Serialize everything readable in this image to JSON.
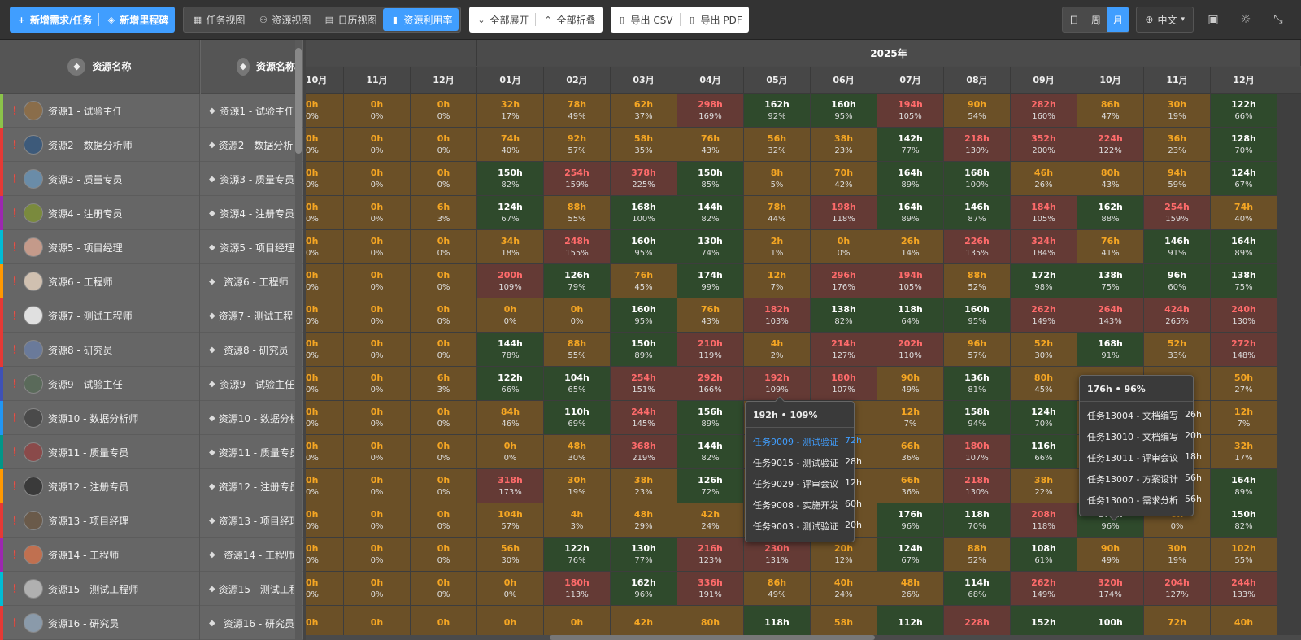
{
  "toolbar": {
    "add_task": "新增需求/任务",
    "add_milestone": "新增里程碑",
    "views": [
      "任务视图",
      "资源视图",
      "日历视图",
      "资源利用率"
    ],
    "active_view": 3,
    "expand_all": "全部展开",
    "collapse_all": "全部折叠",
    "export_csv": "导出 CSV",
    "export_pdf": "导出 PDF",
    "scale": [
      "日",
      "周",
      "月"
    ],
    "active_scale": 2,
    "language": "中文"
  },
  "left_header": {
    "col1": "资源名称",
    "col2": "资源名称"
  },
  "resources": [
    {
      "name": "资源1 - 试验主任",
      "stripe": "#8bc34a",
      "avatar": "#8a6d4a"
    },
    {
      "name": "资源2 - 数据分析师",
      "stripe": "#e53935",
      "avatar": "#3d5a7a"
    },
    {
      "name": "资源3 - 质量专员",
      "stripe": "#e53935",
      "avatar": "#6a8ca8"
    },
    {
      "name": "资源4 - 注册专员",
      "stripe": "#9c27b0",
      "avatar": "#7a8a3d"
    },
    {
      "name": "资源5 - 项目经理",
      "stripe": "#00bcd4",
      "avatar": "#c49a8a"
    },
    {
      "name": "资源6 - 工程师",
      "stripe": "#ff9800",
      "avatar": "#d0c0b0"
    },
    {
      "name": "资源7 - 测试工程师",
      "stripe": "#e53935",
      "avatar": "#e0e0e0"
    },
    {
      "name": "资源8 - 研究员",
      "stripe": "#e53935",
      "avatar": "#6a7a9a"
    },
    {
      "name": "资源9 - 试验主任",
      "stripe": "#3f51b5",
      "avatar": "#5a6a5a"
    },
    {
      "name": "资源10 - 数据分析师",
      "stripe": "#2196f3",
      "avatar": "#4a4a4a"
    },
    {
      "name": "资源11 - 质量专员",
      "stripe": "#009688",
      "avatar": "#8a4a4a"
    },
    {
      "name": "资源12 - 注册专员",
      "stripe": "#ff9800",
      "avatar": "#3a3a3a"
    },
    {
      "name": "资源13 - 项目经理",
      "stripe": "#e53935",
      "avatar": "#6a5a4a"
    },
    {
      "name": "资源14 - 工程师",
      "stripe": "#9c27b0",
      "avatar": "#c07050"
    },
    {
      "name": "资源15 - 测试工程师",
      "stripe": "#00bcd4",
      "avatar": "#b0b0b0"
    },
    {
      "name": "资源16 - 研究员",
      "stripe": "#e53935",
      "avatar": "#8a9aaa"
    }
  ],
  "year_label": "2025年",
  "months": [
    "10月",
    "11月",
    "12月",
    "01月",
    "02月",
    "03月",
    "04月",
    "05月",
    "06月",
    "07月",
    "08月",
    "09月",
    "10月",
    "11月",
    "12月"
  ],
  "cells": [
    [
      [
        "0h",
        "0%"
      ],
      [
        "0h",
        "0%"
      ],
      [
        "0h",
        "0%"
      ],
      [
        "32h",
        "17%"
      ],
      [
        "78h",
        "49%"
      ],
      [
        "62h",
        "37%"
      ],
      [
        "298h",
        "169%"
      ],
      [
        "162h",
        "92%"
      ],
      [
        "160h",
        "95%"
      ],
      [
        "194h",
        "105%"
      ],
      [
        "90h",
        "54%"
      ],
      [
        "282h",
        "160%"
      ],
      [
        "86h",
        "47%"
      ],
      [
        "30h",
        "19%"
      ],
      [
        "122h",
        "66%"
      ]
    ],
    [
      [
        "0h",
        "0%"
      ],
      [
        "0h",
        "0%"
      ],
      [
        "0h",
        "0%"
      ],
      [
        "74h",
        "40%"
      ],
      [
        "92h",
        "57%"
      ],
      [
        "58h",
        "35%"
      ],
      [
        "76h",
        "43%"
      ],
      [
        "56h",
        "32%"
      ],
      [
        "38h",
        "23%"
      ],
      [
        "142h",
        "77%"
      ],
      [
        "218h",
        "130%"
      ],
      [
        "352h",
        "200%"
      ],
      [
        "224h",
        "122%"
      ],
      [
        "36h",
        "23%"
      ],
      [
        "128h",
        "70%"
      ]
    ],
    [
      [
        "0h",
        "0%"
      ],
      [
        "0h",
        "0%"
      ],
      [
        "0h",
        "0%"
      ],
      [
        "150h",
        "82%"
      ],
      [
        "254h",
        "159%"
      ],
      [
        "378h",
        "225%"
      ],
      [
        "150h",
        "85%"
      ],
      [
        "8h",
        "5%"
      ],
      [
        "70h",
        "42%"
      ],
      [
        "164h",
        "89%"
      ],
      [
        "168h",
        "100%"
      ],
      [
        "46h",
        "26%"
      ],
      [
        "80h",
        "43%"
      ],
      [
        "94h",
        "59%"
      ],
      [
        "124h",
        "67%"
      ]
    ],
    [
      [
        "0h",
        "0%"
      ],
      [
        "0h",
        "0%"
      ],
      [
        "6h",
        "3%"
      ],
      [
        "124h",
        "67%"
      ],
      [
        "88h",
        "55%"
      ],
      [
        "168h",
        "100%"
      ],
      [
        "144h",
        "82%"
      ],
      [
        "78h",
        "44%"
      ],
      [
        "198h",
        "118%"
      ],
      [
        "164h",
        "89%"
      ],
      [
        "146h",
        "87%"
      ],
      [
        "184h",
        "105%"
      ],
      [
        "162h",
        "88%"
      ],
      [
        "254h",
        "159%"
      ],
      [
        "74h",
        "40%"
      ]
    ],
    [
      [
        "0h",
        "0%"
      ],
      [
        "0h",
        "0%"
      ],
      [
        "0h",
        "0%"
      ],
      [
        "34h",
        "18%"
      ],
      [
        "248h",
        "155%"
      ],
      [
        "160h",
        "95%"
      ],
      [
        "130h",
        "74%"
      ],
      [
        "2h",
        "1%"
      ],
      [
        "0h",
        "0%"
      ],
      [
        "26h",
        "14%"
      ],
      [
        "226h",
        "135%"
      ],
      [
        "324h",
        "184%"
      ],
      [
        "76h",
        "41%"
      ],
      [
        "146h",
        "91%"
      ],
      [
        "164h",
        "89%"
      ]
    ],
    [
      [
        "0h",
        "0%"
      ],
      [
        "0h",
        "0%"
      ],
      [
        "0h",
        "0%"
      ],
      [
        "200h",
        "109%"
      ],
      [
        "126h",
        "79%"
      ],
      [
        "76h",
        "45%"
      ],
      [
        "174h",
        "99%"
      ],
      [
        "12h",
        "7%"
      ],
      [
        "296h",
        "176%"
      ],
      [
        "194h",
        "105%"
      ],
      [
        "88h",
        "52%"
      ],
      [
        "172h",
        "98%"
      ],
      [
        "138h",
        "75%"
      ],
      [
        "96h",
        "60%"
      ],
      [
        "138h",
        "75%"
      ]
    ],
    [
      [
        "0h",
        "0%"
      ],
      [
        "0h",
        "0%"
      ],
      [
        "0h",
        "0%"
      ],
      [
        "0h",
        "0%"
      ],
      [
        "0h",
        "0%"
      ],
      [
        "160h",
        "95%"
      ],
      [
        "76h",
        "43%"
      ],
      [
        "182h",
        "103%"
      ],
      [
        "138h",
        "82%"
      ],
      [
        "118h",
        "64%"
      ],
      [
        "160h",
        "95%"
      ],
      [
        "262h",
        "149%"
      ],
      [
        "264h",
        "143%"
      ],
      [
        "424h",
        "265%"
      ],
      [
        "240h",
        "130%"
      ]
    ],
    [
      [
        "0h",
        "0%"
      ],
      [
        "0h",
        "0%"
      ],
      [
        "0h",
        "0%"
      ],
      [
        "144h",
        "78%"
      ],
      [
        "88h",
        "55%"
      ],
      [
        "150h",
        "89%"
      ],
      [
        "210h",
        "119%"
      ],
      [
        "4h",
        "2%"
      ],
      [
        "214h",
        "127%"
      ],
      [
        "202h",
        "110%"
      ],
      [
        "96h",
        "57%"
      ],
      [
        "52h",
        "30%"
      ],
      [
        "168h",
        "91%"
      ],
      [
        "52h",
        "33%"
      ],
      [
        "272h",
        "148%"
      ]
    ],
    [
      [
        "0h",
        "0%"
      ],
      [
        "0h",
        "0%"
      ],
      [
        "6h",
        "3%"
      ],
      [
        "122h",
        "66%"
      ],
      [
        "104h",
        "65%"
      ],
      [
        "254h",
        "151%"
      ],
      [
        "292h",
        "166%"
      ],
      [
        "192h",
        "109%"
      ],
      [
        "180h",
        "107%"
      ],
      [
        "90h",
        "49%"
      ],
      [
        "136h",
        "81%"
      ],
      [
        "80h",
        "45%"
      ],
      [
        "",
        ""
      ],
      [
        "",
        ""
      ],
      [
        "50h",
        "27%"
      ]
    ],
    [
      [
        "0h",
        "0%"
      ],
      [
        "0h",
        "0%"
      ],
      [
        "0h",
        "0%"
      ],
      [
        "84h",
        "46%"
      ],
      [
        "110h",
        "69%"
      ],
      [
        "244h",
        "145%"
      ],
      [
        "156h",
        "89%"
      ],
      [
        "",
        ""
      ],
      [
        "",
        ""
      ],
      [
        "12h",
        "7%"
      ],
      [
        "158h",
        "94%"
      ],
      [
        "124h",
        "70%"
      ],
      [
        "",
        ""
      ],
      [
        "",
        ""
      ],
      [
        "12h",
        "7%"
      ]
    ],
    [
      [
        "0h",
        "0%"
      ],
      [
        "0h",
        "0%"
      ],
      [
        "0h",
        "0%"
      ],
      [
        "0h",
        "0%"
      ],
      [
        "48h",
        "30%"
      ],
      [
        "368h",
        "219%"
      ],
      [
        "144h",
        "82%"
      ],
      [
        "",
        ""
      ],
      [
        "",
        ""
      ],
      [
        "66h",
        "36%"
      ],
      [
        "180h",
        "107%"
      ],
      [
        "116h",
        "66%"
      ],
      [
        "",
        ""
      ],
      [
        "",
        ""
      ],
      [
        "32h",
        "17%"
      ]
    ],
    [
      [
        "0h",
        "0%"
      ],
      [
        "0h",
        "0%"
      ],
      [
        "0h",
        "0%"
      ],
      [
        "318h",
        "173%"
      ],
      [
        "30h",
        "19%"
      ],
      [
        "38h",
        "23%"
      ],
      [
        "126h",
        "72%"
      ],
      [
        "",
        ""
      ],
      [
        "",
        ""
      ],
      [
        "66h",
        "36%"
      ],
      [
        "218h",
        "130%"
      ],
      [
        "38h",
        "22%"
      ],
      [
        "",
        ""
      ],
      [
        "",
        ""
      ],
      [
        "164h",
        "89%"
      ]
    ],
    [
      [
        "0h",
        "0%"
      ],
      [
        "0h",
        "0%"
      ],
      [
        "0h",
        "0%"
      ],
      [
        "104h",
        "57%"
      ],
      [
        "4h",
        "3%"
      ],
      [
        "48h",
        "29%"
      ],
      [
        "42h",
        "24%"
      ],
      [
        "",
        ""
      ],
      [
        "",
        ""
      ],
      [
        "176h",
        "96%"
      ],
      [
        "118h",
        "70%"
      ],
      [
        "208h",
        "118%"
      ],
      [
        "176h",
        "96%"
      ],
      [
        "0h",
        "0%"
      ],
      [
        "150h",
        "82%"
      ]
    ],
    [
      [
        "0h",
        "0%"
      ],
      [
        "0h",
        "0%"
      ],
      [
        "0h",
        "0%"
      ],
      [
        "56h",
        "30%"
      ],
      [
        "122h",
        "76%"
      ],
      [
        "130h",
        "77%"
      ],
      [
        "216h",
        "123%"
      ],
      [
        "230h",
        "131%"
      ],
      [
        "20h",
        "12%"
      ],
      [
        "124h",
        "67%"
      ],
      [
        "88h",
        "52%"
      ],
      [
        "108h",
        "61%"
      ],
      [
        "90h",
        "49%"
      ],
      [
        "30h",
        "19%"
      ],
      [
        "102h",
        "55%"
      ]
    ],
    [
      [
        "0h",
        "0%"
      ],
      [
        "0h",
        "0%"
      ],
      [
        "0h",
        "0%"
      ],
      [
        "0h",
        "0%"
      ],
      [
        "180h",
        "113%"
      ],
      [
        "162h",
        "96%"
      ],
      [
        "336h",
        "191%"
      ],
      [
        "86h",
        "49%"
      ],
      [
        "40h",
        "24%"
      ],
      [
        "48h",
        "26%"
      ],
      [
        "114h",
        "68%"
      ],
      [
        "262h",
        "149%"
      ],
      [
        "320h",
        "174%"
      ],
      [
        "204h",
        "127%"
      ],
      [
        "244h",
        "133%"
      ]
    ],
    [
      [
        "0h",
        ""
      ],
      [
        "0h",
        ""
      ],
      [
        "0h",
        ""
      ],
      [
        "0h",
        ""
      ],
      [
        "0h",
        ""
      ],
      [
        "42h",
        ""
      ],
      [
        "80h",
        ""
      ],
      [
        "118h",
        ""
      ],
      [
        "58h",
        ""
      ],
      [
        "112h",
        ""
      ],
      [
        "228h",
        ""
      ],
      [
        "152h",
        ""
      ],
      [
        "100h",
        ""
      ],
      [
        "72h",
        ""
      ],
      [
        "40h",
        ""
      ]
    ]
  ],
  "tooltip1": {
    "title": "192h • 109%",
    "items": [
      {
        "task": "任务9009 - 测试验证",
        "hours": "72h"
      },
      {
        "task": "任务9015 - 测试验证",
        "hours": "28h"
      },
      {
        "task": "任务9029 - 评审会议",
        "hours": "12h"
      },
      {
        "task": "任务9008 - 实施开发",
        "hours": "60h"
      },
      {
        "task": "任务9003 - 测试验证",
        "hours": "20h"
      }
    ]
  },
  "tooltip2": {
    "title": "176h • 96%",
    "items": [
      {
        "task": "任务13004 - 文档编写",
        "hours": "26h"
      },
      {
        "task": "任务13010 - 文档编写",
        "hours": "20h"
      },
      {
        "task": "任务13011 - 评审会议",
        "hours": "18h"
      },
      {
        "task": "任务13007 - 方案设计",
        "hours": "56h"
      },
      {
        "task": "任务13000 - 需求分析",
        "hours": "56h"
      }
    ]
  }
}
